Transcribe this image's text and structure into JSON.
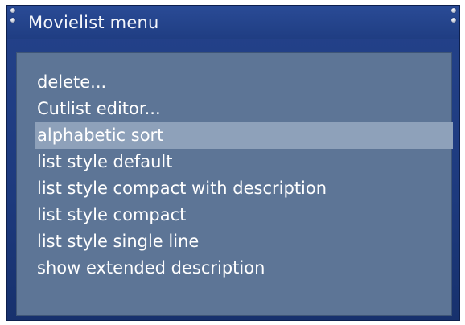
{
  "window": {
    "title": "Movielist menu"
  },
  "menu": {
    "items": [
      {
        "label": "delete..."
      },
      {
        "label": "Cutlist editor..."
      },
      {
        "label": "alphabetic sort",
        "selected": true
      },
      {
        "label": "list style default"
      },
      {
        "label": "list style compact with description"
      },
      {
        "label": "list style compact"
      },
      {
        "label": "list style single line"
      },
      {
        "label": "show extended description"
      }
    ]
  },
  "colors": {
    "frame": "#1f3d82",
    "content_bg": "#5d7596",
    "selection": "#8ea1ba",
    "text": "#ffffff"
  }
}
